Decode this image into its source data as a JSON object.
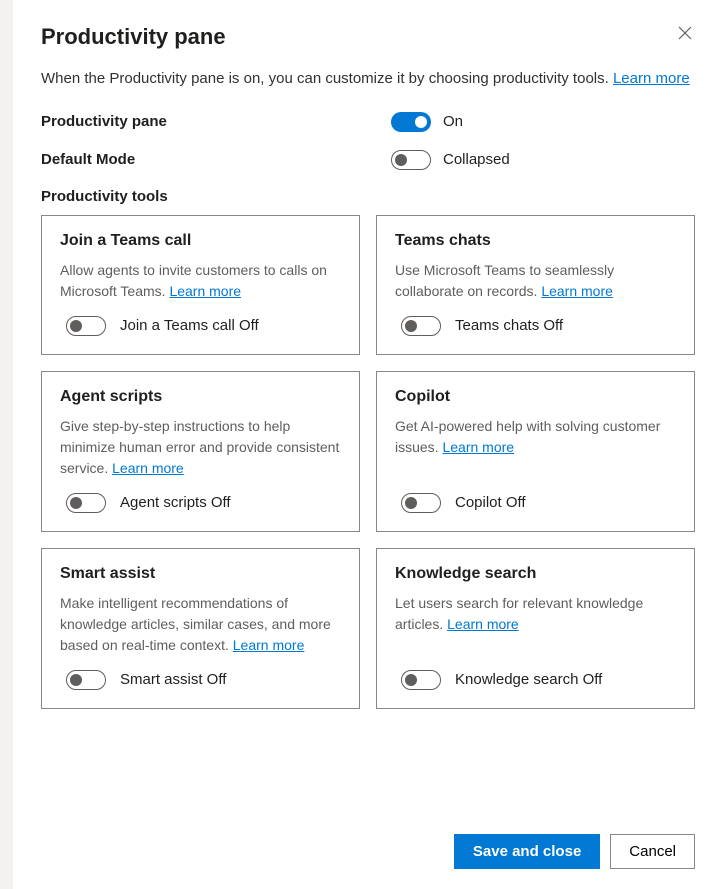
{
  "dialog": {
    "title": "Productivity pane",
    "intro_text": "When the Productivity pane is on, you can customize it by choosing productivity tools. ",
    "learn_more": "Learn more"
  },
  "settings": {
    "pane_label": "Productivity pane",
    "pane_state": "On",
    "mode_label": "Default Mode",
    "mode_state": "Collapsed"
  },
  "tools_heading": "Productivity tools",
  "tools": [
    {
      "title": "Join a Teams call",
      "desc": "Allow agents to invite customers to calls on Microsoft Teams. ",
      "learn_more": "Learn more",
      "toggle_label": "Join a Teams call Off"
    },
    {
      "title": "Teams chats",
      "desc": "Use Microsoft Teams to seamlessly collaborate on records. ",
      "learn_more": "Learn more",
      "toggle_label": "Teams chats Off"
    },
    {
      "title": "Agent scripts",
      "desc": "Give step-by-step instructions to help minimize human error and provide consistent service. ",
      "learn_more": "Learn more",
      "toggle_label": "Agent scripts Off"
    },
    {
      "title": "Copilot",
      "desc": "Get AI-powered help with solving customer issues. ",
      "learn_more": "Learn more",
      "toggle_label": "Copilot Off"
    },
    {
      "title": "Smart assist",
      "desc": "Make intelligent recommendations of knowledge articles, similar cases, and more based on real-time context. ",
      "learn_more": "Learn more",
      "toggle_label": "Smart assist Off"
    },
    {
      "title": "Knowledge search",
      "desc": "Let users search for relevant knowledge articles. ",
      "learn_more": "Learn more",
      "toggle_label": "Knowledge search Off"
    }
  ],
  "footer": {
    "save": "Save and close",
    "cancel": "Cancel"
  }
}
